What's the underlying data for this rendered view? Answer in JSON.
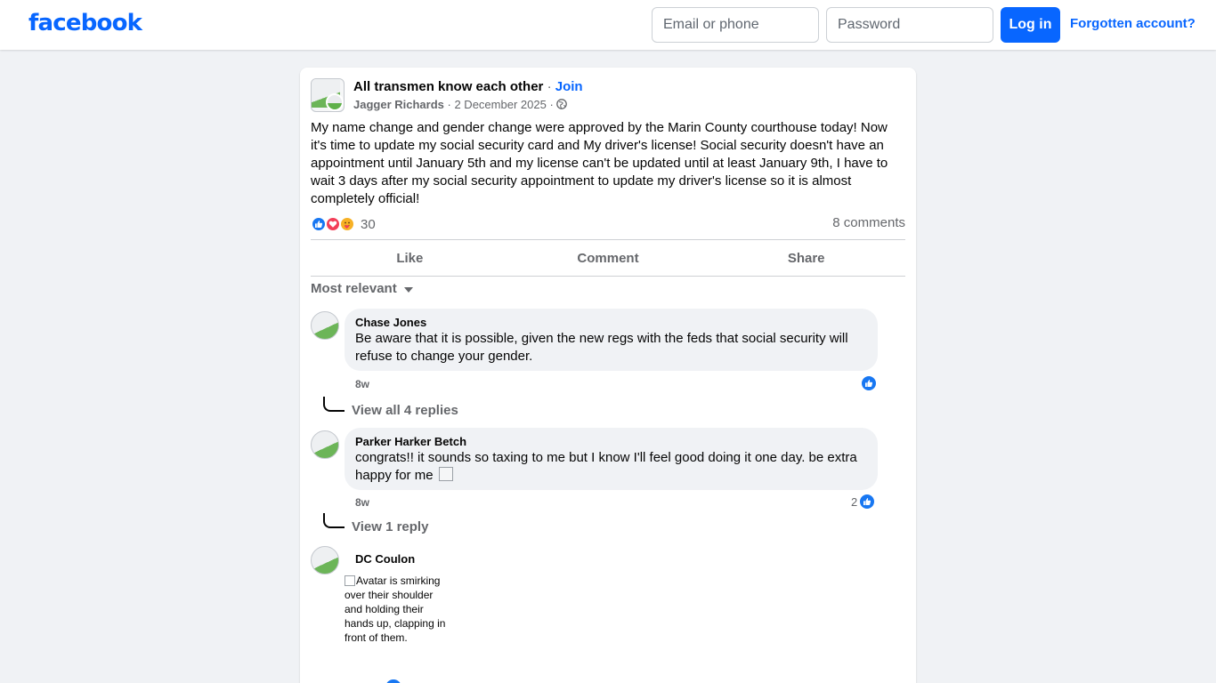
{
  "header": {
    "logo": "facebook",
    "email_placeholder": "Email or phone",
    "password_placeholder": "Password",
    "login_label": "Log in",
    "forgot_label": "Forgotten account?"
  },
  "post": {
    "group_name": "All transmen know each other",
    "separator": "·",
    "join_label": "Join",
    "author": "Jagger Richards",
    "date": "2 December 2025",
    "text": "My name change and gender change were approved by the Marin County courthouse today! Now it's time to update my social security card and My driver's license! Social security doesn't have an appointment until January 5th and my license can't be updated until at least January 9th, I have to wait 3 days after my social security appointment to update my driver's license so it is almost completely official!",
    "reaction_count": "30",
    "comments_count": "8 comments",
    "actions": [
      "Like",
      "Comment",
      "Share"
    ],
    "sort_label": "Most relevant"
  },
  "comments": [
    {
      "name": "Chase Jones",
      "text": "Be aware that it is possible, given the new regs with the feds that social security will refuse to change your gender.",
      "time": "8w",
      "replies_label": "View all 4 replies"
    },
    {
      "name": "Parker Harker Betch",
      "text": "congrats!! it sounds so taxing to me but I know I'll feel good doing it one day. be extra happy for me",
      "time": "8w",
      "like_count": "2",
      "replies_label": "View 1 reply"
    },
    {
      "name": "DC Coulon",
      "sticker_alt": "Avatar is smirking over their shoulder and holding their hands up, clapping in front of them."
    }
  ],
  "colors": {
    "brand": "#0866ff",
    "background": "#f0f2f5",
    "secondary_text": "#65676b",
    "like_blue": "#1877f2",
    "love_red": "#f33e58",
    "care_yellow": "#f7b125"
  },
  "icons": [
    "globe-icon",
    "like-reaction-icon",
    "love-reaction-icon",
    "care-reaction-icon",
    "caret-down-icon",
    "thumbs-up-icon"
  ]
}
